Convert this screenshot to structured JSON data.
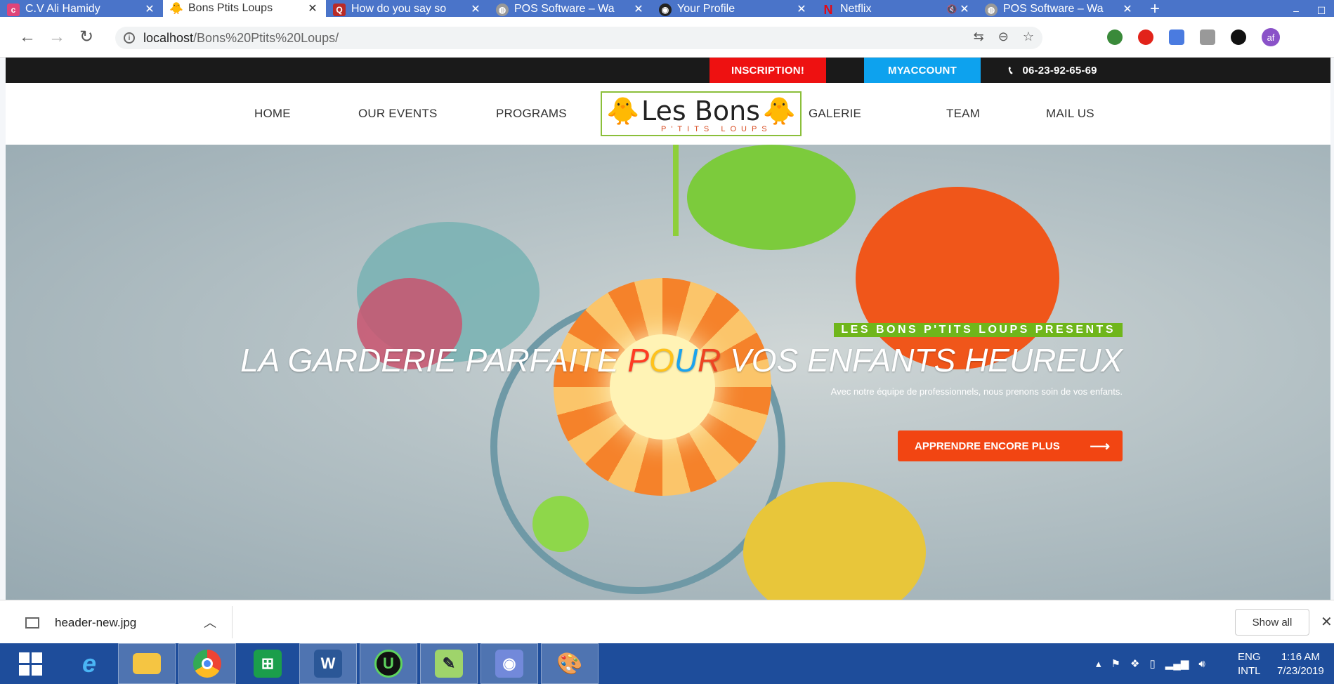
{
  "browser": {
    "tabs": [
      {
        "title": "C.V Ali Hamidy",
        "fav": "c",
        "color": "#e0447a"
      },
      {
        "title": "Bons Ptits Loups",
        "fav": "duck",
        "color": "#ffc21a",
        "active": true
      },
      {
        "title": "How do you say so",
        "fav": "Q",
        "color": "#b92b27"
      },
      {
        "title": "POS Software – Wa",
        "fav": "globe",
        "color": "#888"
      },
      {
        "title": "Your Profile",
        "fav": "github",
        "color": "#222"
      },
      {
        "title": "Netflix",
        "fav": "N",
        "color": "#e50914",
        "muted": true
      },
      {
        "title": "POS Software – Wa",
        "fav": "globe",
        "color": "#888"
      }
    ],
    "new_tab": "+",
    "url_host": "localhost",
    "url_path": "/Bons%20Ptits%20Loups/",
    "avatar": "af"
  },
  "site": {
    "topbar": {
      "inscription": "INSCRIPTION!",
      "account": "MYACCOUNT",
      "phone": "06-23-92-65-69"
    },
    "nav": {
      "home": "HOME",
      "events": "OUR EVENTS",
      "programs": "PROGRAMS",
      "galerie": "GALERIE",
      "team": "TEAM",
      "mail": "MAIL US"
    },
    "logo": {
      "main": "Les Bons",
      "sub": "P'TITS LOUPS"
    },
    "hero": {
      "presents": "LES BONS P'TITS LOUPS PRESENTS",
      "headline_before": "LA GARDERIE PARFAITE ",
      "headline_p": "P",
      "headline_o": "O",
      "headline_u": "U",
      "headline_r": "R",
      "headline_after": " VOS ENFANTS HEUREUX",
      "subline": "Avec notre équipe de professionnels, nous prenons soin de vos enfants.",
      "cta": "APPRENDRE ENCORE PLUS"
    }
  },
  "download": {
    "file": "header-new.jpg",
    "show_all": "Show all"
  },
  "taskbar": {
    "lang1": "ENG",
    "lang2": "INTL",
    "time": "1:16 AM",
    "date": "7/23/2019"
  }
}
